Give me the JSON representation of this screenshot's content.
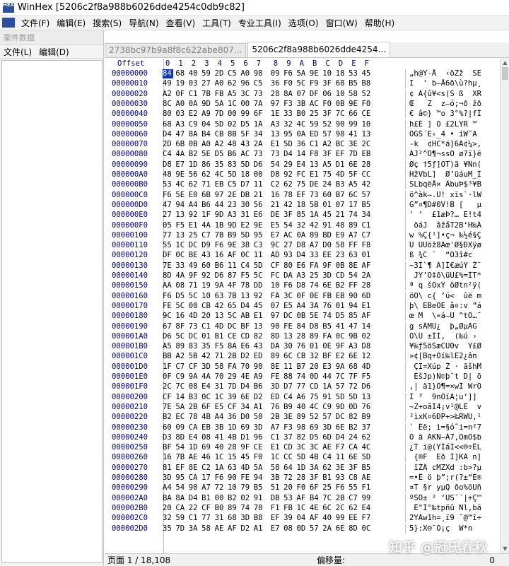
{
  "window": {
    "app_name": "WinHex",
    "title": "[5206c2f8a988b6026dde4254c0db9c82]"
  },
  "menu": [
    "文件(F)",
    "编辑(E)",
    "搜索(S)",
    "导航(N)",
    "查看(V)",
    "工具(T)",
    "专业工具(I)",
    "选项(O)",
    "窗口(W)",
    "帮助(H)"
  ],
  "case_panel": {
    "header": "案件数据",
    "menu": [
      "文件(L)",
      "编辑(D)"
    ]
  },
  "tabs": [
    {
      "label": "2738bc97b9a8f8c622abe807...",
      "active": false
    },
    {
      "label": "5206c2f8a988b6026dde4254...",
      "active": true
    }
  ],
  "hex_header": {
    "offset_label": "Offset",
    "columns": [
      "0",
      "1",
      "2",
      "3",
      "4",
      "5",
      "6",
      "7",
      "8",
      "9",
      "A",
      "B",
      "C",
      "D",
      "E",
      "F"
    ]
  },
  "rows": [
    {
      "offset": "00000000",
      "hex": "84 68 40 59 2D C5 A0 98 09 F6 5A 9E 10 18 53 45",
      "text": "„h@Y-Å  ‹öZž  SE"
    },
    {
      "offset": "00000010",
      "hex": "49 19 03 27 A0 62 96 C5 36 F0 5C F9 3F 68 B5 B8",
      "text": "I  ' b–Å6ð\\ù?hµ¸"
    },
    {
      "offset": "00000020",
      "hex": "A2 0F C1 7B FB A5 3C 73 28 8A 07 DF 06 10 58 52",
      "text": "¢ Á{û¥<s(Š ß  XR"
    },
    {
      "offset": "00000030",
      "hex": "8C A0 0A 9D 5A 1C 00 7A 97 F3 3B AC F0 0B 9E F0",
      "text": "Œ   Z  z—ó;¬ð žð"
    },
    {
      "offset": "00000040",
      "hex": "80 03 E2 A9 7D 00 99 6F 1E 33 B0 25 3F 7C 66 CE",
      "text": "€ â©} ™o 3°%?|fÎ"
    },
    {
      "offset": "00000050",
      "hex": "68 A3 C9 04 5D 02 D5 1A A3 32 4C 59 52 90 99 10",
      "text": "h£É ] Õ £2LYR ™ "
    },
    {
      "offset": "00000060",
      "hex": "D4 47 8A B4 CB 8B 5F 34 13 95 0A ED 57 98 41 13",
      "text": "ÔGŠ´Ë‹_4 • íW˜A "
    },
    {
      "offset": "00000070",
      "hex": "2D 6B 0B A0 A2 48 43 2A E1 5D 36 C1 A2 BC 3E 2C",
      "text": "-k  ¢HC*á]6Á¢¼>,"
    },
    {
      "offset": "00000080",
      "hex": "C4 4A B2 5E D5 B6 AC 73 73 D4 14 F8 3F EF 7D EB",
      "text": "ÄJ²^Õ¶¬ssÔ ø?ï}ë"
    },
    {
      "offset": "00000090",
      "hex": "D8 E7 1D 86 35 83 5D D6 54 29 E4 13 A5 D1 6E 28",
      "text": "Øç †5ƒ]ÖT)ä ¥Ñn("
    },
    {
      "offset": "000000A0",
      "hex": "48 9E 56 62 4C 5D 18 00 D8 92 FC E1 75 4D 5F CC",
      "text": "HžVbL]  Ø’üáuM_Ì"
    },
    {
      "offset": "000000B0",
      "hex": "53 4C 62 71 EB C5 D7 11 C2 62 75 DE 24 B3 A5 42",
      "text": "SLbqëÅ× ÂbuÞ$³¥B"
    },
    {
      "offset": "000000C0",
      "hex": "F6 5E E0 6B 97 2E DB 21 16 78 EF 73 60 B7 6C 57",
      "text": "ö^àk—.Û! xïs`·lW"
    },
    {
      "offset": "000000D0",
      "hex": "47 94 A4 B6 44 23 30 56 21 42 18 5B 01 07 17 B5",
      "text": "G”¤¶D#0V!B [   µ"
    },
    {
      "offset": "000000E0",
      "hex": "27 13 92 1F 9D A3 31 E6 DE 3F 85 1A 45 21 74 34",
      "text": "' ’  £1æÞ?… E!t4"
    },
    {
      "offset": "000000F0",
      "hex": "05 F5 E1 4A 1B 9D E2 9E E5 54 32 42 91 48 89 C1",
      "text": " õáJ  âžåT2B‘H‰Á"
    },
    {
      "offset": "00000100",
      "hex": "77 13 25 C7 7B B9 5D 95 E7 AC 0A 89 BD E9 A7 C7",
      "text": "w %Ç{¹]•ç¬ ‰½é§Ç"
    },
    {
      "offset": "00000110",
      "hex": "55 1C DC D9 F6 9E 38 C3 9C 27 D8 A7 D0 58 FF F8",
      "text": "U ÜÙöž8Ãœ'Ø§ÐXÿø"
    },
    {
      "offset": "00000120",
      "hex": "DF 0C BE 43 16 AF 0C 11 AD 93 D4 33 EE 23 63 01",
      "text": "ß ¾C ¯  ­“Ô3î#c "
    },
    {
      "offset": "00000130",
      "hex": "7E 33 49 60 B6 11 C4 5D CF 80 E6 FA 9F 0B 8E AF",
      "text": "~3I`¶ Ä]Ï€æúŸ Ž¯"
    },
    {
      "offset": "00000140",
      "hex": "8D 4A 9F 92 D6 87 F5 5C FC DA A3 25 3D CD 54 2A",
      "text": " JŸ’Ö‡õ\\üÚ£%=ÍT*"
    },
    {
      "offset": "00000150",
      "hex": "AA 08 71 19 9A 4F 78 DD 10 F6 D8 74 6E B2 FF 28",
      "text": "ª q šOxÝ öØtn²ÿ("
    },
    {
      "offset": "00000160",
      "hex": "F6 D5 5C 10 63 7B 13 92 FA 3C 0F 0E FB EB 90 6D",
      "text": "öÕ\\ c{ ’ú<  ûë m"
    },
    {
      "offset": "00000170",
      "hex": "FE 5C 00 CB 42 65 D4 45 07 E5 A4 3A 76 01 94 E1",
      "text": "þ\\ ËBeÔE å¤:v ”á"
    },
    {
      "offset": "00000180",
      "hex": "9C 16 4D 20 13 5C AB E1 97 DC 0B 5E 74 D5 85 AF",
      "text": "œ M  \\«á—Ü ^tÕ…¯"
    },
    {
      "offset": "00000190",
      "hex": "67 8F 73 C1 4D DC BF 13 90 FE 84 D8 B5 41 47 14",
      "text": "g sÁMÜ¿  þ„ØµAG "
    },
    {
      "offset": "000001A0",
      "hex": "D6 5C DC 01 B1 CE CD 82 8D 13 28 89 FA 0C 9B 02",
      "text": "Ö\\Ü ±ÎÍ‚  (‰ú › "
    },
    {
      "offset": "000001B0",
      "hex": "A5 89 83 35 F5 8A E6 43 DA 30 76 01 0E 9F A3 D8",
      "text": "¥‰ƒ5õŠæCÚ0v  Ÿ£Ø"
    },
    {
      "offset": "000001C0",
      "hex": "BB A2 5B 42 71 2B D2 ED 89 6C CB 32 BF E2 6E 12",
      "text": "»¢[Bq+Òí‰lË2¿ân "
    },
    {
      "offset": "000001D0",
      "hex": "1F C7 CF 3D 58 FA 70 90 8E 11 B7 20 E3 9A 68 4D",
      "text": " ÇÏ=Xúp Ž · ãšhM"
    },
    {
      "offset": "000001E0",
      "hex": "0F C9 9A 4A 70 29 4E A9 FE 88 74 0D 44 7C 7F F5",
      "text": " ÉšJp)N©þˆt D| õ"
    },
    {
      "offset": "000001F0",
      "hex": "2C 7C 08 E4 31 7D D4 B6 3D D7 77 CD 1A 57 72 D6",
      "text": ",| ä1}Ô¶=×wÍ WrÖ"
    },
    {
      "offset": "00000200",
      "hex": "CF 14 B3 0C 1C 39 6E D2 ED C4 A6 75 91 5D 5D 13",
      "text": "Ï ³  9nÒíÄ¦u‘]] "
    },
    {
      "offset": "00000210",
      "hex": "7E 5A 2B 6F E5 CF 34 A1 76 B9 40 4C C9 9D 0D 76",
      "text": "~Z+oåÏ4¡v¹@LÉ  v"
    },
    {
      "offset": "00000220",
      "hex": "B2 EC 78 4B A4 36 D0 50 2B 3E 89 52 57 DC 82 B9",
      "text": "²ìxK¤6ÐP+>‰RWÜ‚¹"
    },
    {
      "offset": "00000230",
      "hex": "60 09 CA EB 3B 1D 69 3D A7 F3 98 69 3D 6E B2 37",
      "text": "` Êë; i=§ó˜i=n²7"
    },
    {
      "offset": "00000240",
      "hex": "D3 8D E4 08 41 4B D1 96 C1 37 82 D5 6D D4 24 62",
      "text": "Ó ä AKÑ–Á7‚ÕmÔ$b"
    },
    {
      "offset": "00000250",
      "hex": "BF 54 1D 69 40 28 9F CE E1 CD 3C 3C AE F7 CA 4C",
      "text": "¿T i@(ŸÎáÍ<<®÷ÊL"
    },
    {
      "offset": "00000260",
      "hex": "16 7B AE 46 1C 15 45 F0 1C CC 5D 4B C4 11 6E 5D",
      "text": " {®F  Eð Ì]KÄ n]"
    },
    {
      "offset": "00000270",
      "hex": "81 EF 8E C2 1A 63 4D 5A 58 64 1D 3A 62 3E 3F B5",
      "text": " ïŽÂ cMZXd :b>?µ"
    },
    {
      "offset": "00000280",
      "hex": "3D 95 CA 17 F6 90 FE 94 3B 72 28 3F B1 93 C8 AE",
      "text": "=•Ê ö þ”;r(?±“È®"
    },
    {
      "offset": "00000290",
      "hex": "A4 54 90 A7 72 10 79 B5 51 20 F0 6F 25 F6 55 F1",
      "text": "¤T §r yµQ ðo%öUñ"
    },
    {
      "offset": "000002A0",
      "hex": "BA 8A D4 B1 00 B2 02 91 DB 53 AF B4 7C 2B C7 99",
      "text": "ºŠÔ± ² ‘ÛS¯´|+Ç™"
    },
    {
      "offset": "000002B0",
      "hex": "20 CA 22 CF B0 89 74 70 F1 FB 1C 4E 6C 2C 62 E4",
      "text": " Ê\"Ï°‰tpñû Nl,bä"
    },
    {
      "offset": "000002C0",
      "hex": "32 59 C1 77 31 68 3D B8 EF 39 04 AF 40 99 EE F7",
      "text": "2YÁw1h=¸ï9 ¯@™î÷"
    },
    {
      "offset": "000002D0",
      "hex": "35 7D 3A 58 AE AF D2 A1 E7 08 0D 57 2A 6E 8D 0C",
      "text": "5}:X®¯Ò¡ç  W*n  "
    }
  ],
  "statusbar": {
    "page": "页面 1 / 18,108",
    "offset_label": "偏移量:",
    "offset_value": "0"
  },
  "watermark": "知乎 @冠氏春秋",
  "colors": {
    "cursor": "#0a36c0",
    "offset_text": "#000080",
    "app_icon": "#2b4f9e"
  }
}
